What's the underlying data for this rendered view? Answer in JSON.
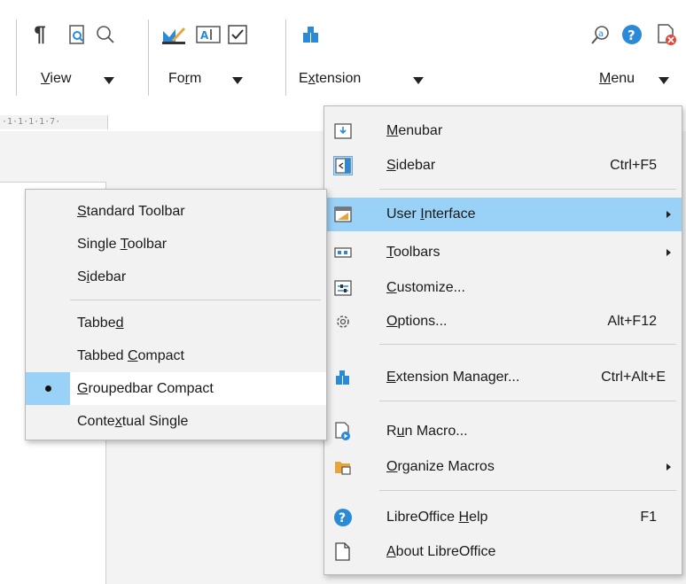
{
  "toolbar": {
    "groups": [
      {
        "label": "View",
        "mnemonic": "V",
        "rest": "iew"
      },
      {
        "label": "Form",
        "mnemonic": "r",
        "pre": "Fo",
        "rest": "m"
      },
      {
        "label": "Extension",
        "pre": "E",
        "mnemonic": "x",
        "rest": "tension"
      },
      {
        "label": "Menu",
        "mnemonic": "M",
        "rest": "enu"
      }
    ]
  },
  "ruler": {
    "text": "·1·1·1·1·7·"
  },
  "main_menu": {
    "items": [
      {
        "label": "Menubar",
        "mn": "M",
        "rest": "enubar",
        "shortcut": "",
        "icon": "menubar-icon"
      },
      {
        "label": "Sidebar",
        "mn": "S",
        "rest": "idebar",
        "shortcut": "Ctrl+F5",
        "icon": "sidebar-icon"
      },
      {
        "label": "User Interface",
        "pre": "User ",
        "mn": "I",
        "rest": "nterface",
        "shortcut": "",
        "icon": "user-interface-icon",
        "submenu": true,
        "highlight": true
      },
      {
        "label": "Toolbars",
        "mn": "T",
        "rest": "oolbars",
        "shortcut": "",
        "icon": "toolbars-icon",
        "submenu": true
      },
      {
        "label": "Customize...",
        "mn": "C",
        "rest": "ustomize...",
        "shortcut": "",
        "icon": "customize-icon"
      },
      {
        "label": "Options...",
        "mn": "O",
        "rest": "ptions...",
        "shortcut": "Alt+F12",
        "icon": "options-icon"
      },
      {
        "label": "Extension Manager...",
        "mn": "E",
        "rest": "xtension Manager...",
        "shortcut": "Ctrl+Alt+E",
        "icon": "extension-manager-icon"
      },
      {
        "label": "Run Macro...",
        "pre": "R",
        "mn": "u",
        "rest": "n Macro...",
        "shortcut": "",
        "icon": "run-macro-icon"
      },
      {
        "label": "Organize Macros",
        "mn": "O",
        "rest": "rganize Macros",
        "shortcut": "",
        "icon": "organize-macros-icon",
        "submenu": true
      },
      {
        "label": "LibreOffice Help",
        "pre": "LibreOffice ",
        "mn": "H",
        "rest": "elp",
        "shortcut": "F1",
        "icon": "help-icon"
      },
      {
        "label": "About LibreOffice",
        "mn": "A",
        "rest": "bout LibreOffice",
        "shortcut": "",
        "icon": "about-icon"
      }
    ]
  },
  "ui_submenu": {
    "items": [
      {
        "label": "Standard Toolbar",
        "mn": "S",
        "rest": "tandard Toolbar"
      },
      {
        "label": "Single Toolbar",
        "pre": "Single ",
        "mn": "T",
        "rest": "oolbar"
      },
      {
        "label": "Sidebar",
        "pre": "S",
        "mn": "i",
        "rest": "debar"
      },
      {
        "label": "Tabbed",
        "pre": "Tabbe",
        "mn": "d",
        "rest": ""
      },
      {
        "label": "Tabbed Compact",
        "pre": "Tabbed ",
        "mn": "C",
        "rest": "ompact"
      },
      {
        "label": "Groupedbar Compact",
        "mn": "G",
        "rest": "roupedbar Compact",
        "checked": true
      },
      {
        "label": "Contextual Single",
        "pre": "Conte",
        "mn": "x",
        "rest": "tual Single"
      }
    ]
  },
  "colors": {
    "highlight": "#99d1f7",
    "menu_bg": "#f2f2f2",
    "help_blue": "#2a8ad8"
  }
}
